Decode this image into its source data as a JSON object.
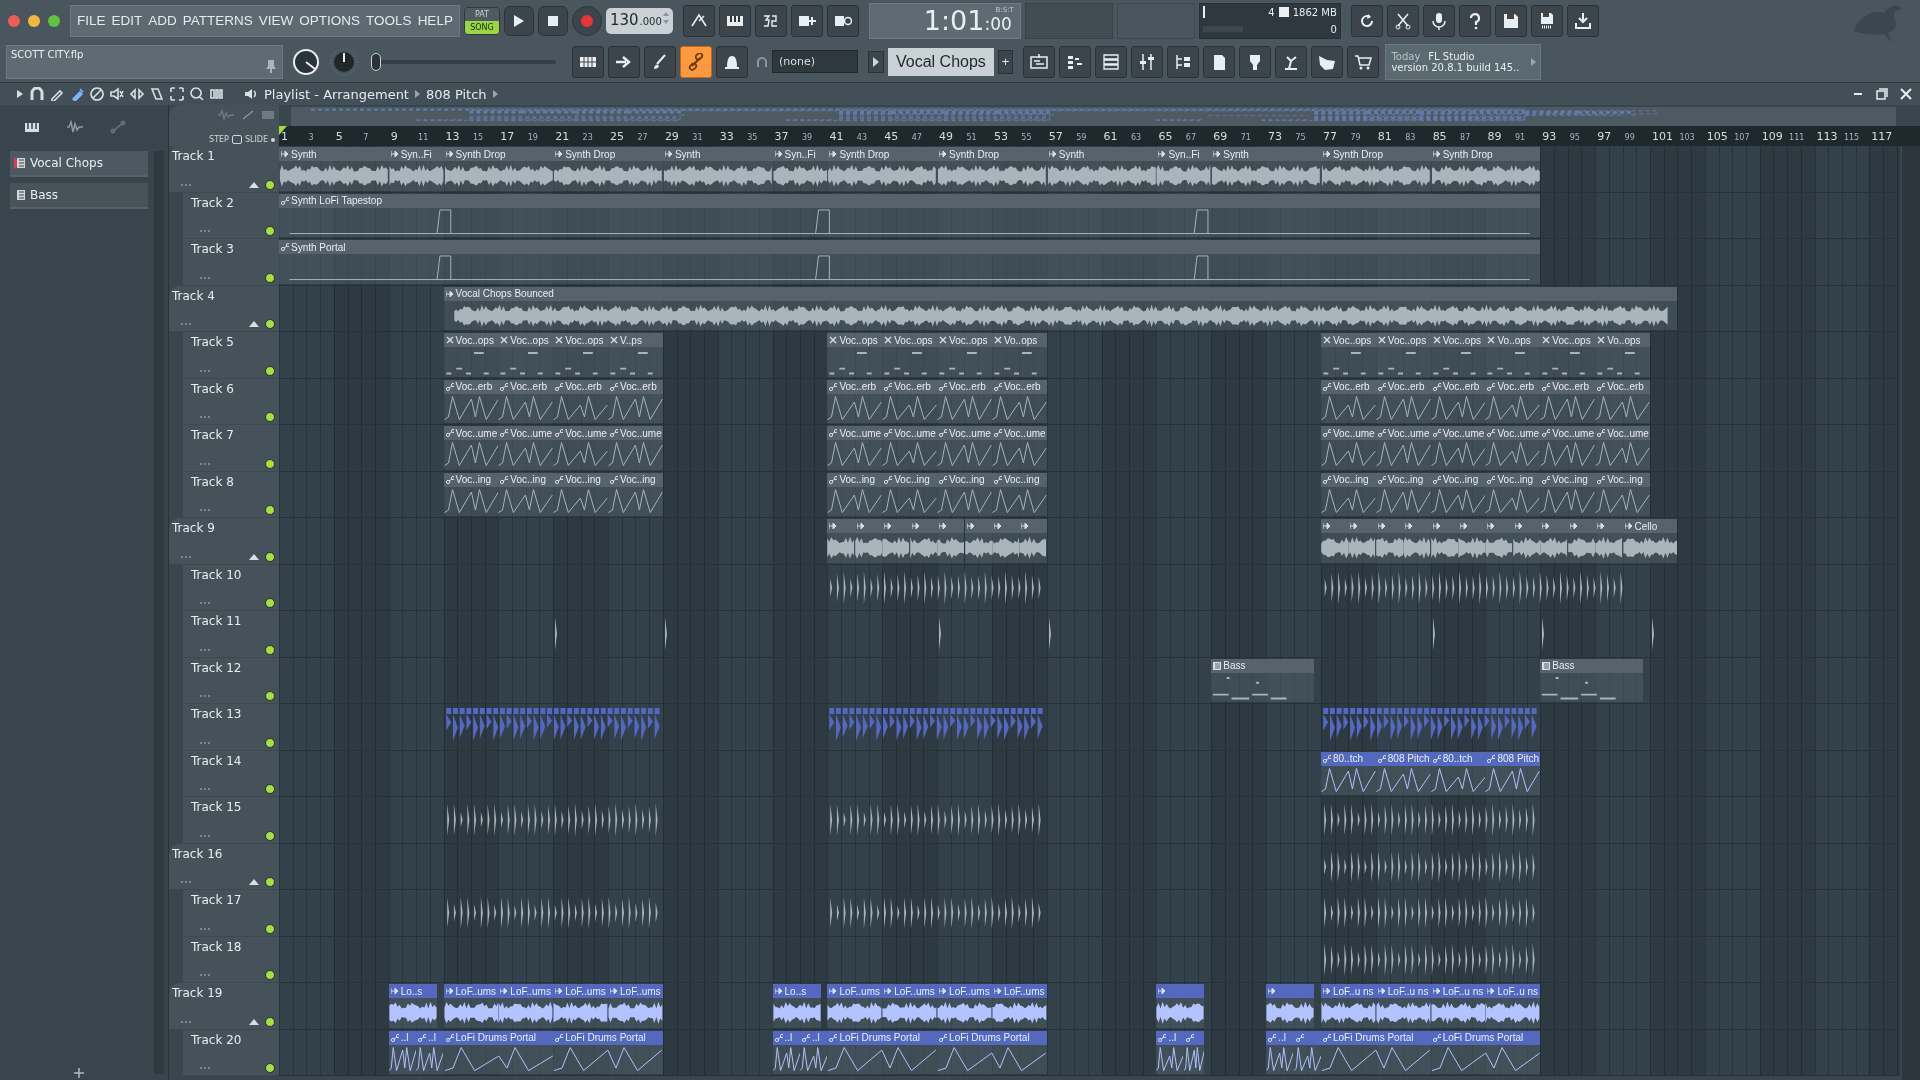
{
  "menu": [
    "FILE",
    "EDIT",
    "ADD",
    "PATTERNS",
    "VIEW",
    "OPTIONS",
    "TOOLS",
    "HELP"
  ],
  "mode": [
    {
      "label": "PAT",
      "selected": false
    },
    {
      "label": "SONG",
      "selected": true
    }
  ],
  "tempo": {
    "value": "130",
    "fraction": ".000"
  },
  "time": {
    "main": "1:01",
    "sub": ":00",
    "unit": "B:S:T"
  },
  "monitor": {
    "voices": "4",
    "memory": "1862 MB",
    "polyphony": "0"
  },
  "file_name": "SCOTT CITY.flp",
  "master_slider": {
    "level": 0
  },
  "channel_target": "(none)",
  "pattern": "Vocal Chops",
  "add_pattern": "+",
  "hint": {
    "day": "Today",
    "app": "FL Studio",
    "version": "version 20.8.1 build 145.."
  },
  "playlist": {
    "title": "Playlist - Arrangement",
    "clip": "808 Pitch",
    "step": "STEP",
    "slide": "SLIDE"
  },
  "picker": [
    {
      "label": "Vocal Chops",
      "selected": true
    },
    {
      "label": "Bass",
      "selected": false
    }
  ],
  "ruler": [
    "1",
    "3",
    "5",
    "7",
    "9",
    "11",
    "13",
    "15",
    "17",
    "19",
    "21",
    "23",
    "25",
    "27",
    "29",
    "31",
    "33",
    "35",
    "37",
    "39",
    "41",
    "43",
    "45",
    "47",
    "49",
    "51",
    "53",
    "55",
    "57",
    "59",
    "61",
    "63",
    "65",
    "67",
    "69",
    "71",
    "73",
    "75",
    "77",
    "79",
    "81",
    "83",
    "85",
    "87",
    "89",
    "91",
    "93",
    "95",
    "97",
    "99",
    "101",
    "103",
    "105",
    "107",
    "109",
    "111",
    "113",
    "115",
    "117"
  ],
  "tracks": [
    {
      "name": "Track 1",
      "kind": "group",
      "enabled": true,
      "clips": [
        {
          "label": "Synth",
          "kind": "audio"
        },
        {
          "label": "Syn..Fi",
          "kind": "audio"
        },
        {
          "label": "Synth Drop",
          "kind": "audio"
        },
        {
          "label": "Synth Drop",
          "kind": "audio"
        },
        {
          "label": "Synth",
          "kind": "audio"
        },
        {
          "label": "Syn..Fi",
          "kind": "audio"
        },
        {
          "label": "Synth Drop",
          "kind": "audio"
        },
        {
          "label": "Synth Drop",
          "kind": "audio"
        },
        {
          "label": "Synth",
          "kind": "audio"
        },
        {
          "label": "Syn..Fi",
          "kind": "audio"
        },
        {
          "label": "Synth",
          "kind": "audio"
        },
        {
          "label": "Synth Drop",
          "kind": "audio"
        },
        {
          "label": "Synth Drop",
          "kind": "audio"
        }
      ]
    },
    {
      "name": "Track 2",
      "kind": "track",
      "enabled": true,
      "clips": [
        {
          "label": "Synth LoFi Tapestop",
          "kind": "automation"
        }
      ]
    },
    {
      "name": "Track 3",
      "kind": "track",
      "enabled": true,
      "clips": [
        {
          "label": "Synth Portal",
          "kind": "automation"
        }
      ]
    },
    {
      "name": "Track 4",
      "kind": "group",
      "enabled": true,
      "clips": [
        {
          "label": "Vocal Chops Bounced",
          "kind": "audio"
        }
      ]
    },
    {
      "name": "Track 5",
      "kind": "track",
      "enabled": true,
      "clips": [
        {
          "label": "Voc..ops",
          "kind": "pattern"
        },
        {
          "label": "Voc..ops",
          "kind": "pattern"
        },
        {
          "label": "Voc..ops",
          "kind": "pattern"
        },
        {
          "label": "V..ps",
          "kind": "pattern"
        },
        {
          "label": "Voc..ops",
          "kind": "pattern"
        },
        {
          "label": "Voc..ops",
          "kind": "pattern"
        },
        {
          "label": "Voc..ops",
          "kind": "pattern"
        },
        {
          "label": "Vo..ops",
          "kind": "pattern"
        },
        {
          "label": "Voc..ops",
          "kind": "pattern"
        },
        {
          "label": "Voc..ops",
          "kind": "pattern"
        },
        {
          "label": "Voc..ops",
          "kind": "pattern"
        },
        {
          "label": "Vo..ops",
          "kind": "pattern"
        },
        {
          "label": "Voc..ops",
          "kind": "pattern"
        },
        {
          "label": "Vo..ops",
          "kind": "pattern"
        }
      ]
    },
    {
      "name": "Track 6",
      "kind": "track",
      "enabled": true,
      "clips": [
        {
          "label": "Voc..erb",
          "kind": "automation"
        },
        {
          "label": "Voc..erb",
          "kind": "automation"
        },
        {
          "label": "Voc..erb",
          "kind": "automation"
        },
        {
          "label": "Voc..erb",
          "kind": "automation"
        },
        {
          "label": "Voc..erb",
          "kind": "automation"
        },
        {
          "label": "Voc..erb",
          "kind": "automation"
        },
        {
          "label": "Voc..erb",
          "kind": "automation"
        },
        {
          "label": "Voc..erb",
          "kind": "automation"
        },
        {
          "label": "Voc..erb",
          "kind": "automation"
        },
        {
          "label": "Voc..erb",
          "kind": "automation"
        },
        {
          "label": "Voc..erb",
          "kind": "automation"
        },
        {
          "label": "Voc..erb",
          "kind": "automation"
        },
        {
          "label": "Voc..erb",
          "kind": "automation"
        },
        {
          "label": "Voc..erb",
          "kind": "automation"
        }
      ]
    },
    {
      "name": "Track 7",
      "kind": "track",
      "enabled": true,
      "clips": [
        {
          "label": "Voc..ume",
          "kind": "automation"
        },
        {
          "label": "Voc..ume",
          "kind": "automation"
        },
        {
          "label": "Voc..ume",
          "kind": "automation"
        },
        {
          "label": "Voc..ume",
          "kind": "automation"
        },
        {
          "label": "Voc..ume",
          "kind": "automation"
        },
        {
          "label": "Voc..ume",
          "kind": "automation"
        },
        {
          "label": "Voc..ume",
          "kind": "automation"
        },
        {
          "label": "Voc..ume",
          "kind": "automation"
        },
        {
          "label": "Voc..ume",
          "kind": "automation"
        },
        {
          "label": "Voc..ume",
          "kind": "automation"
        },
        {
          "label": "Voc..ume",
          "kind": "automation"
        },
        {
          "label": "Voc..ume",
          "kind": "automation"
        },
        {
          "label": "Voc..ume",
          "kind": "automation"
        },
        {
          "label": "Voc..ume",
          "kind": "automation"
        }
      ]
    },
    {
      "name": "Track 8",
      "kind": "track",
      "enabled": true,
      "clips": [
        {
          "label": "Voc..ing",
          "kind": "automation"
        },
        {
          "label": "Voc..ing",
          "kind": "automation"
        },
        {
          "label": "Voc..ing",
          "kind": "automation"
        },
        {
          "label": "Voc..ing",
          "kind": "automation"
        },
        {
          "label": "Voc..ing",
          "kind": "automation"
        },
        {
          "label": "Voc..ing",
          "kind": "automation"
        },
        {
          "label": "Voc..ing",
          "kind": "automation"
        },
        {
          "label": "Voc..ing",
          "kind": "automation"
        },
        {
          "label": "Voc..ing",
          "kind": "automation"
        },
        {
          "label": "Voc..ing",
          "kind": "automation"
        },
        {
          "label": "Voc..ing",
          "kind": "automation"
        },
        {
          "label": "Voc..ing",
          "kind": "automation"
        },
        {
          "label": "Voc..ing",
          "kind": "automation"
        },
        {
          "label": "Voc..ing",
          "kind": "automation"
        }
      ]
    },
    {
      "name": "Track 9",
      "kind": "group",
      "enabled": true,
      "clips": [
        {
          "kind": "audio"
        },
        {
          "kind": "audio"
        },
        {
          "kind": "audio"
        },
        {
          "kind": "audio"
        },
        {
          "kind": "audio"
        },
        {
          "kind": "audio"
        },
        {
          "kind": "audio"
        },
        {
          "kind": "audio"
        },
        {
          "kind": "audio"
        },
        {
          "kind": "audio"
        },
        {
          "kind": "audio"
        },
        {
          "kind": "audio"
        },
        {
          "kind": "audio"
        },
        {
          "kind": "audio"
        },
        {
          "kind": "audio"
        },
        {
          "kind": "audio"
        },
        {
          "kind": "audio"
        },
        {
          "kind": "audio"
        },
        {
          "kind": "audio"
        },
        {
          "label": "Cello",
          "kind": "audio"
        }
      ]
    },
    {
      "name": "Track 10",
      "kind": "track",
      "enabled": true,
      "clips": [
        {
          "kind": "hits"
        },
        {
          "kind": "hits"
        }
      ]
    },
    {
      "name": "Track 11",
      "kind": "track",
      "enabled": true,
      "clips": [
        {
          "kind": "hits"
        },
        {
          "kind": "hits"
        },
        {
          "kind": "hits"
        },
        {
          "kind": "hits"
        },
        {
          "kind": "hits"
        },
        {
          "kind": "hits"
        },
        {
          "kind": "hits"
        }
      ]
    },
    {
      "name": "Track 12",
      "kind": "track",
      "enabled": true,
      "clips": [
        {
          "label": "Bass",
          "kind": "notes"
        },
        {
          "label": "Bass",
          "kind": "notes"
        }
      ]
    },
    {
      "name": "Track 13",
      "kind": "track",
      "enabled": true,
      "color": "#5468c0",
      "clips": [
        {
          "kind": "hits"
        },
        {
          "kind": "hits"
        },
        {
          "kind": "hits"
        }
      ]
    },
    {
      "name": "Track 14",
      "kind": "track",
      "enabled": true,
      "color": "#5468c0",
      "clips": [
        {
          "label": "80..tch",
          "kind": "automation"
        },
        {
          "label": "808 Pitch",
          "kind": "automation"
        },
        {
          "label": "80..tch",
          "kind": "automation"
        },
        {
          "label": "808 Pitch",
          "kind": "automation"
        }
      ]
    },
    {
      "name": "Track 15",
      "kind": "track",
      "enabled": true,
      "clips": [
        {
          "kind": "hits"
        },
        {
          "kind": "hits"
        },
        {
          "kind": "hits"
        }
      ]
    },
    {
      "name": "Track 16",
      "kind": "group",
      "enabled": true,
      "clips": [
        {
          "kind": "hits"
        }
      ]
    },
    {
      "name": "Track 17",
      "kind": "track",
      "enabled": true,
      "clips": [
        {
          "kind": "hits"
        },
        {
          "kind": "hits"
        },
        {
          "kind": "hits"
        }
      ]
    },
    {
      "name": "Track 18",
      "kind": "track",
      "enabled": true,
      "clips": [
        {
          "kind": "hits"
        }
      ]
    },
    {
      "name": "Track 19",
      "kind": "group",
      "enabled": true,
      "color": "#5468c0",
      "clips": [
        {
          "label": "Lo..s",
          "kind": "audio"
        },
        {
          "label": "LoF..ums",
          "kind": "audio"
        },
        {
          "label": "LoF..ums",
          "kind": "audio"
        },
        {
          "label": "LoF..ums",
          "kind": "audio"
        },
        {
          "label": "LoF..ums",
          "kind": "audio"
        },
        {
          "label": "Lo..s",
          "kind": "audio"
        },
        {
          "label": "LoF..ums",
          "kind": "audio"
        },
        {
          "label": "LoF..ums",
          "kind": "audio"
        },
        {
          "label": "LoF..ums",
          "kind": "audio"
        },
        {
          "label": "LoF..ums",
          "kind": "audio"
        },
        {
          "kind": "audio"
        },
        {
          "kind": "audio"
        },
        {
          "label": "LoF..u ns",
          "kind": "audio"
        },
        {
          "label": "LoF..u ns",
          "kind": "audio"
        },
        {
          "label": "LoF..u ns",
          "kind": "audio"
        },
        {
          "label": "LoF..u ns",
          "kind": "audio"
        }
      ]
    },
    {
      "name": "Track 20",
      "kind": "track",
      "enabled": true,
      "color": "#5468c0",
      "clips": [
        {
          "label": "..l",
          "kind": "automation"
        },
        {
          "label": "..l",
          "kind": "automation"
        },
        {
          "label": "LoFi Drums Portal",
          "kind": "automation"
        },
        {
          "label": "LoFi Drums Portal",
          "kind": "automation"
        },
        {
          "label": "..l",
          "kind": "automation"
        },
        {
          "label": "..l",
          "kind": "automation"
        },
        {
          "label": "LoFi Drums Portal",
          "kind": "automation"
        },
        {
          "label": "LoFi Drums Portal",
          "kind": "automation"
        },
        {
          "label": "..l",
          "kind": "automation"
        },
        {
          "kind": "automation"
        },
        {
          "label": "..l",
          "kind": "automation"
        },
        {
          "kind": "automation"
        },
        {
          "label": "LoFi Drums Portal",
          "kind": "automation"
        },
        {
          "label": "LoFi Drums Portal",
          "kind": "automation"
        }
      ]
    }
  ]
}
